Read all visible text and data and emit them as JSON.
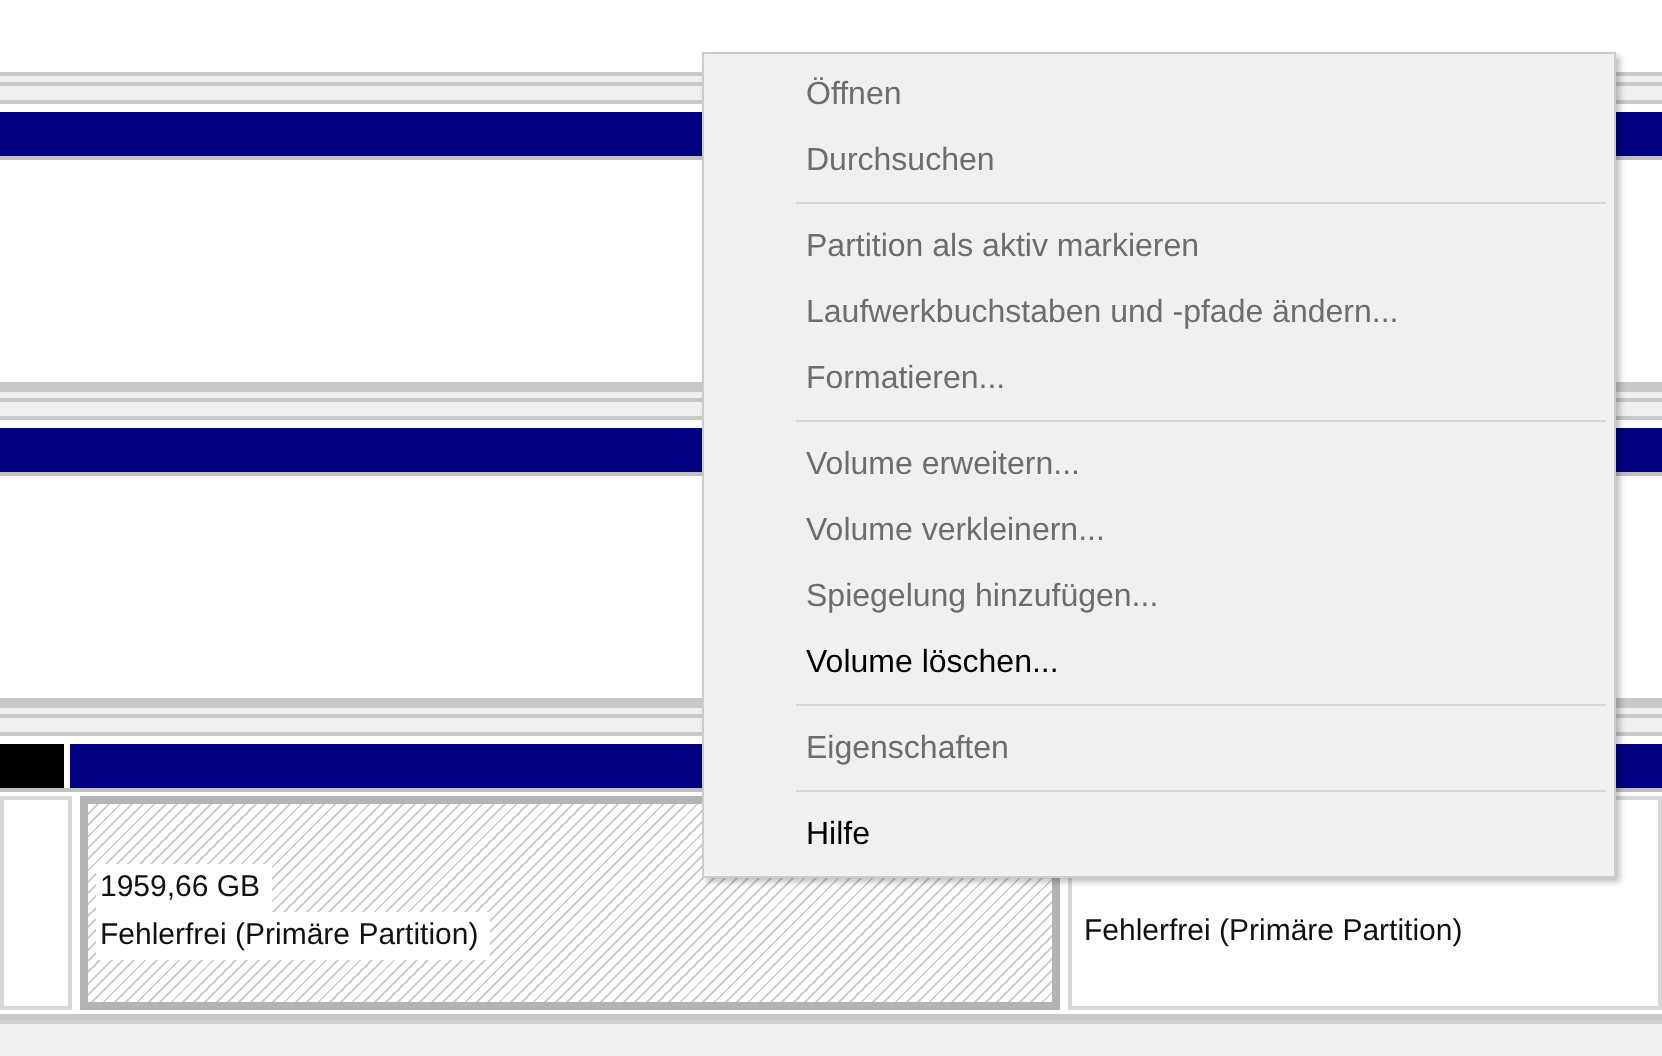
{
  "disks": [
    {
      "partitions": [
        {
          "kind": "bar",
          "color": "#000080"
        }
      ]
    },
    {
      "partitions": [
        {
          "kind": "bar",
          "color": "#000080"
        }
      ]
    },
    {
      "partitions": [
        {
          "kind": "bar",
          "color": "#000000",
          "selected": false
        },
        {
          "kind": "bar",
          "color": "#000080",
          "selected": true,
          "size": "1959,66 GB",
          "status": "Fehlerfrei (Primäre Partition)"
        },
        {
          "kind": "bar",
          "color": "#000080",
          "selected": false,
          "status": "Fehlerfrei (Primäre Partition)"
        }
      ]
    }
  ],
  "context_menu": {
    "items": [
      {
        "kind": "item",
        "label": "Öffnen",
        "disabled": true
      },
      {
        "kind": "item",
        "label": "Durchsuchen",
        "disabled": true
      },
      {
        "kind": "separator"
      },
      {
        "kind": "item",
        "label": "Partition als aktiv markieren",
        "disabled": true
      },
      {
        "kind": "item",
        "label": "Laufwerkbuchstaben und -pfade ändern...",
        "disabled": true
      },
      {
        "kind": "item",
        "label": "Formatieren...",
        "disabled": true
      },
      {
        "kind": "separator"
      },
      {
        "kind": "item",
        "label": "Volume erweitern...",
        "disabled": true
      },
      {
        "kind": "item",
        "label": "Volume verkleinern...",
        "disabled": true
      },
      {
        "kind": "item",
        "label": "Spiegelung hinzufügen...",
        "disabled": true
      },
      {
        "kind": "item",
        "label": "Volume löschen...",
        "disabled": false
      },
      {
        "kind": "separator"
      },
      {
        "kind": "item",
        "label": "Eigenschaften",
        "disabled": true
      },
      {
        "kind": "separator"
      },
      {
        "kind": "item",
        "label": "Hilfe",
        "disabled": false
      }
    ]
  }
}
